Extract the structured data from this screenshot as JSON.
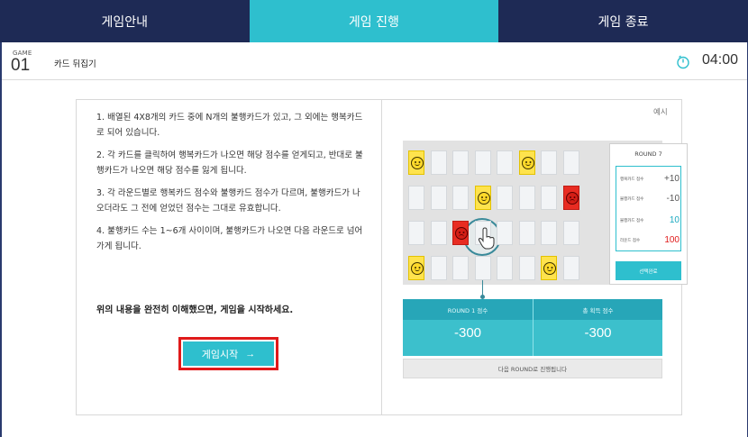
{
  "tabs": [
    {
      "label": "게임안내",
      "active": false
    },
    {
      "label": "게임 진행",
      "active": true
    },
    {
      "label": "게임 종료",
      "active": false
    }
  ],
  "game": {
    "word": "GAME",
    "number": "01",
    "title": "카드 뒤집기",
    "timer": "04:00"
  },
  "instructions": [
    "1. 배열된 4X8개의 카드 중에 N개의 불행카드가 있고, 그 외에는 행복카드로 되어 있습니다.",
    "2. 각 카드를 클릭하여 행복카드가 나오면 해당 점수를 얻게되고, 반대로 불행카드가 나오면 해당 점수를 잃게 됩니다.",
    "3. 각 라운드별로 행복카드 점수와 불행카드 점수가 다르며, 불행카드가 나오더라도 그 전에 얻었던 점수는 그대로 유효합니다.",
    "4. 불행카드 수는 1~6개 사이이며, 불행카드가 나오면 다음 라운드로 넘어가게 됩니다."
  ],
  "confirm_text": "위의 내용을 완전히 이해했으면, 게임을 시작하세요.",
  "start_button": {
    "label": "게임시작",
    "arrow": "→"
  },
  "example": {
    "label": "예시",
    "round_title": "ROUND 7",
    "scores": [
      {
        "label": "행복카드 점수",
        "value": "+10",
        "tone": "gray"
      },
      {
        "label": "불행카드 점수",
        "value": "-10",
        "tone": "gray"
      },
      {
        "label": "불행카드 점수",
        "value": "10",
        "tone": "cyan"
      },
      {
        "label": "라운드 점수",
        "value": "100",
        "tone": "red"
      }
    ],
    "select_button": "선택완료",
    "cards": [
      [
        "happy",
        "blank",
        "blank",
        "blank",
        "blank",
        "happy",
        "blank",
        "blank"
      ],
      [
        "blank",
        "blank",
        "blank",
        "happy",
        "blank",
        "blank",
        "blank",
        "unhappy"
      ],
      [
        "blank",
        "blank",
        "unhappy",
        "blank",
        "blank",
        "blank",
        "blank",
        "blank"
      ],
      [
        "happy",
        "blank",
        "blank",
        "blank",
        "blank",
        "blank",
        "happy",
        "blank"
      ]
    ],
    "round_score_label": "ROUND 1 점수",
    "round_score_value": "-300",
    "total_score_label": "총 획득 점수",
    "total_score_value": "-300",
    "next_round_text": "다음 ROUND로 진행됩니다"
  },
  "colors": {
    "navy": "#1e2a55",
    "accent": "#2ebfce",
    "highlight_red": "#e01a1a"
  }
}
